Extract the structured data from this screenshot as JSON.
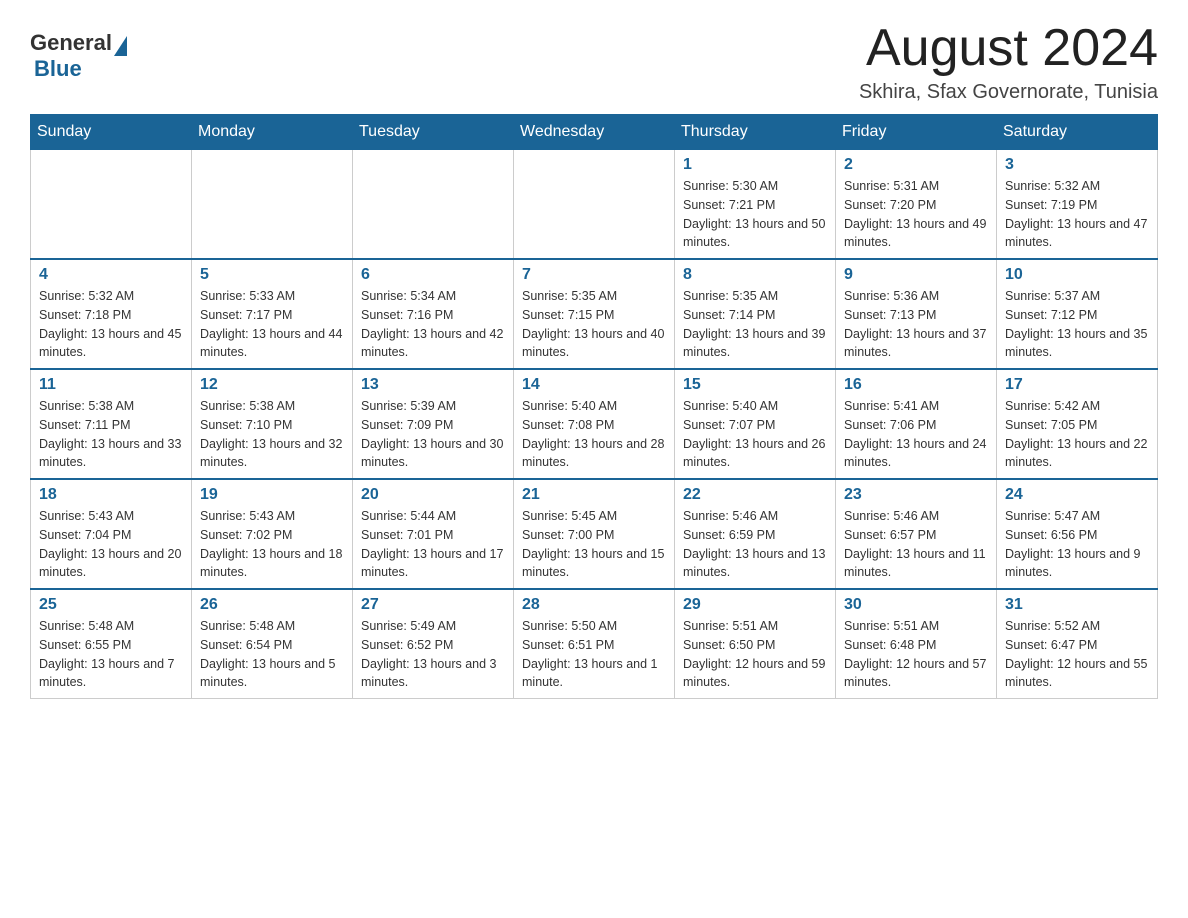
{
  "header": {
    "logo_general": "General",
    "logo_blue": "Blue",
    "title": "August 2024",
    "subtitle": "Skhira, Sfax Governorate, Tunisia"
  },
  "days_of_week": [
    "Sunday",
    "Monday",
    "Tuesday",
    "Wednesday",
    "Thursday",
    "Friday",
    "Saturday"
  ],
  "weeks": [
    [
      {
        "day": "",
        "info": ""
      },
      {
        "day": "",
        "info": ""
      },
      {
        "day": "",
        "info": ""
      },
      {
        "day": "",
        "info": ""
      },
      {
        "day": "1",
        "info": "Sunrise: 5:30 AM\nSunset: 7:21 PM\nDaylight: 13 hours and 50 minutes."
      },
      {
        "day": "2",
        "info": "Sunrise: 5:31 AM\nSunset: 7:20 PM\nDaylight: 13 hours and 49 minutes."
      },
      {
        "day": "3",
        "info": "Sunrise: 5:32 AM\nSunset: 7:19 PM\nDaylight: 13 hours and 47 minutes."
      }
    ],
    [
      {
        "day": "4",
        "info": "Sunrise: 5:32 AM\nSunset: 7:18 PM\nDaylight: 13 hours and 45 minutes."
      },
      {
        "day": "5",
        "info": "Sunrise: 5:33 AM\nSunset: 7:17 PM\nDaylight: 13 hours and 44 minutes."
      },
      {
        "day": "6",
        "info": "Sunrise: 5:34 AM\nSunset: 7:16 PM\nDaylight: 13 hours and 42 minutes."
      },
      {
        "day": "7",
        "info": "Sunrise: 5:35 AM\nSunset: 7:15 PM\nDaylight: 13 hours and 40 minutes."
      },
      {
        "day": "8",
        "info": "Sunrise: 5:35 AM\nSunset: 7:14 PM\nDaylight: 13 hours and 39 minutes."
      },
      {
        "day": "9",
        "info": "Sunrise: 5:36 AM\nSunset: 7:13 PM\nDaylight: 13 hours and 37 minutes."
      },
      {
        "day": "10",
        "info": "Sunrise: 5:37 AM\nSunset: 7:12 PM\nDaylight: 13 hours and 35 minutes."
      }
    ],
    [
      {
        "day": "11",
        "info": "Sunrise: 5:38 AM\nSunset: 7:11 PM\nDaylight: 13 hours and 33 minutes."
      },
      {
        "day": "12",
        "info": "Sunrise: 5:38 AM\nSunset: 7:10 PM\nDaylight: 13 hours and 32 minutes."
      },
      {
        "day": "13",
        "info": "Sunrise: 5:39 AM\nSunset: 7:09 PM\nDaylight: 13 hours and 30 minutes."
      },
      {
        "day": "14",
        "info": "Sunrise: 5:40 AM\nSunset: 7:08 PM\nDaylight: 13 hours and 28 minutes."
      },
      {
        "day": "15",
        "info": "Sunrise: 5:40 AM\nSunset: 7:07 PM\nDaylight: 13 hours and 26 minutes."
      },
      {
        "day": "16",
        "info": "Sunrise: 5:41 AM\nSunset: 7:06 PM\nDaylight: 13 hours and 24 minutes."
      },
      {
        "day": "17",
        "info": "Sunrise: 5:42 AM\nSunset: 7:05 PM\nDaylight: 13 hours and 22 minutes."
      }
    ],
    [
      {
        "day": "18",
        "info": "Sunrise: 5:43 AM\nSunset: 7:04 PM\nDaylight: 13 hours and 20 minutes."
      },
      {
        "day": "19",
        "info": "Sunrise: 5:43 AM\nSunset: 7:02 PM\nDaylight: 13 hours and 18 minutes."
      },
      {
        "day": "20",
        "info": "Sunrise: 5:44 AM\nSunset: 7:01 PM\nDaylight: 13 hours and 17 minutes."
      },
      {
        "day": "21",
        "info": "Sunrise: 5:45 AM\nSunset: 7:00 PM\nDaylight: 13 hours and 15 minutes."
      },
      {
        "day": "22",
        "info": "Sunrise: 5:46 AM\nSunset: 6:59 PM\nDaylight: 13 hours and 13 minutes."
      },
      {
        "day": "23",
        "info": "Sunrise: 5:46 AM\nSunset: 6:57 PM\nDaylight: 13 hours and 11 minutes."
      },
      {
        "day": "24",
        "info": "Sunrise: 5:47 AM\nSunset: 6:56 PM\nDaylight: 13 hours and 9 minutes."
      }
    ],
    [
      {
        "day": "25",
        "info": "Sunrise: 5:48 AM\nSunset: 6:55 PM\nDaylight: 13 hours and 7 minutes."
      },
      {
        "day": "26",
        "info": "Sunrise: 5:48 AM\nSunset: 6:54 PM\nDaylight: 13 hours and 5 minutes."
      },
      {
        "day": "27",
        "info": "Sunrise: 5:49 AM\nSunset: 6:52 PM\nDaylight: 13 hours and 3 minutes."
      },
      {
        "day": "28",
        "info": "Sunrise: 5:50 AM\nSunset: 6:51 PM\nDaylight: 13 hours and 1 minute."
      },
      {
        "day": "29",
        "info": "Sunrise: 5:51 AM\nSunset: 6:50 PM\nDaylight: 12 hours and 59 minutes."
      },
      {
        "day": "30",
        "info": "Sunrise: 5:51 AM\nSunset: 6:48 PM\nDaylight: 12 hours and 57 minutes."
      },
      {
        "day": "31",
        "info": "Sunrise: 5:52 AM\nSunset: 6:47 PM\nDaylight: 12 hours and 55 minutes."
      }
    ]
  ]
}
